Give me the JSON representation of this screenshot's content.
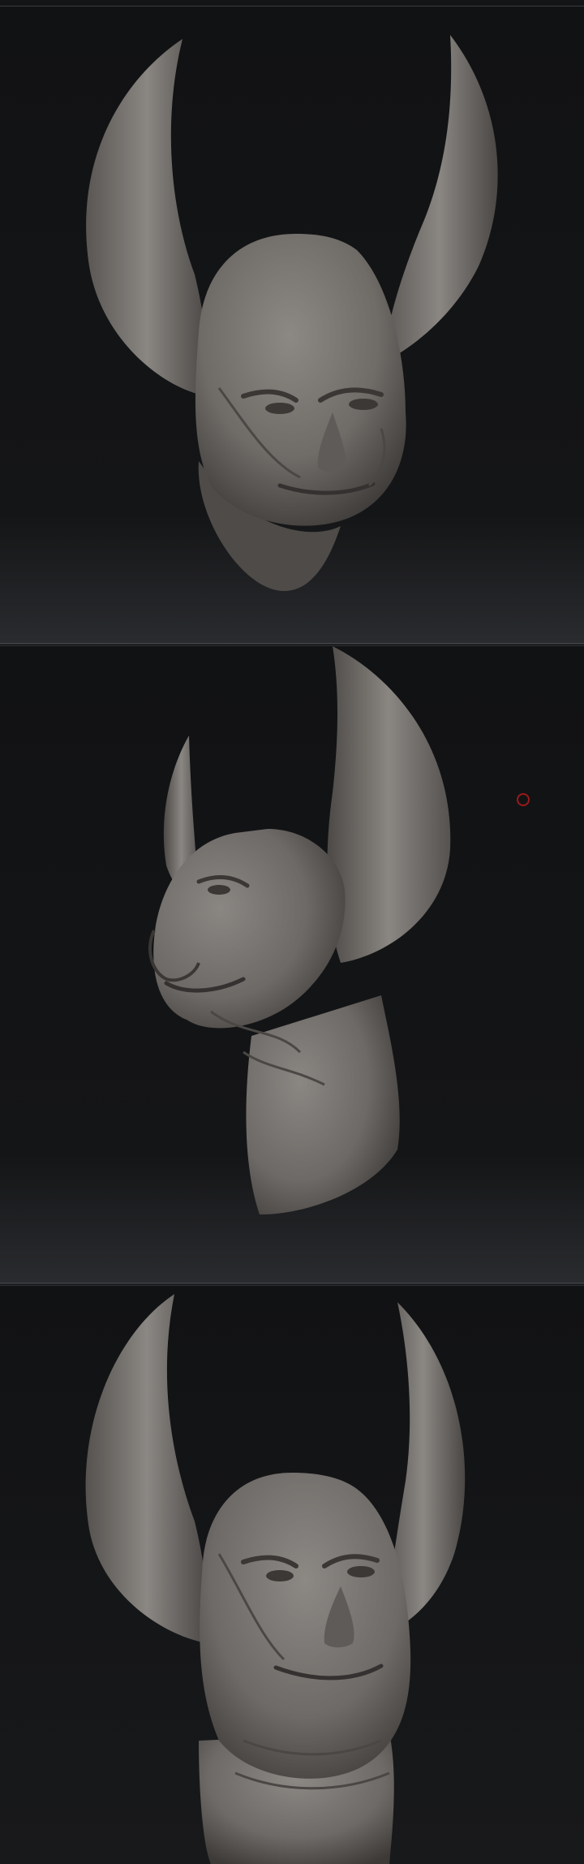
{
  "viewports": [
    {
      "view": "front",
      "background_top": "#121315",
      "background_bottom": "#27282b",
      "model_color": "#7a7672"
    },
    {
      "view": "three-quarter",
      "background_top": "#121315",
      "background_bottom": "#27282b",
      "model_color": "#7a7672"
    },
    {
      "view": "front-low",
      "background_top": "#121315",
      "background_bottom": "#1a1b1d",
      "model_color": "#7a7672"
    }
  ],
  "cursor": {
    "icon": "brush-cursor-icon",
    "color": "#9a1a1a"
  }
}
